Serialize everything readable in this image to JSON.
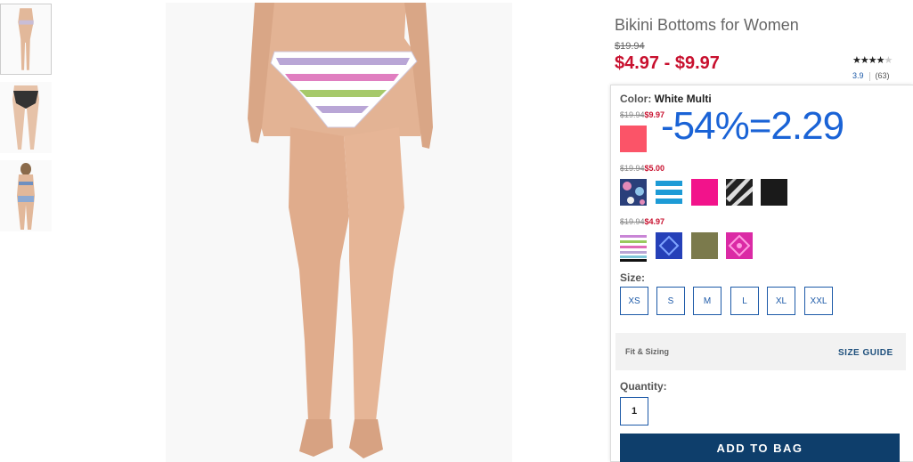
{
  "product": {
    "title": "Bikini Bottoms for Women",
    "original_price": "$19.94",
    "sale_price": "$4.97 - $9.97",
    "rating": 3.9,
    "rating_display": "3.9",
    "review_count": "(63)",
    "stars_filled": 4,
    "stars_total": 5,
    "stars_filled_glyphs": "★★★★",
    "stars_empty_glyphs": "★"
  },
  "color": {
    "label": "Color:",
    "selected": "White Multi"
  },
  "annotation": "-54%=2.29",
  "price_tiers": [
    {
      "strike": "$19.94",
      "now": "$9.97",
      "swatches": [
        {
          "name": "coral",
          "color": "#fb5468"
        }
      ]
    },
    {
      "strike": "$19.94",
      "now": "$5.00",
      "swatches": [
        {
          "name": "navy-floral",
          "color": "#2a3f7a"
        },
        {
          "name": "blue-stripe",
          "color": "#1d9bd6"
        },
        {
          "name": "hot-pink",
          "color": "#f2138b"
        },
        {
          "name": "black-white-print",
          "color": "#222222"
        },
        {
          "name": "black",
          "color": "#1a1a1a"
        }
      ]
    },
    {
      "strike": "$19.94",
      "now": "$4.97",
      "swatches": [
        {
          "name": "white-multi",
          "color": "#e9d8ef"
        },
        {
          "name": "cobalt-geo",
          "color": "#2540b8"
        },
        {
          "name": "olive",
          "color": "#7b7a4c"
        },
        {
          "name": "magenta-geo",
          "color": "#db2aa5"
        }
      ]
    }
  ],
  "size": {
    "label": "Size:",
    "options": [
      "XS",
      "S",
      "M",
      "L",
      "XL",
      "XXL"
    ]
  },
  "fit": {
    "label": "Fit & Sizing",
    "guide": "SIZE GUIDE"
  },
  "quantity": {
    "label": "Quantity:",
    "value": "1"
  },
  "add_to_bag": "ADD TO BAG",
  "colors": {
    "accent_blue": "#1d5aa8",
    "sale_red": "#c8102e",
    "button_navy": "#0e3e6b",
    "annotation_blue": "#1a63d6"
  }
}
